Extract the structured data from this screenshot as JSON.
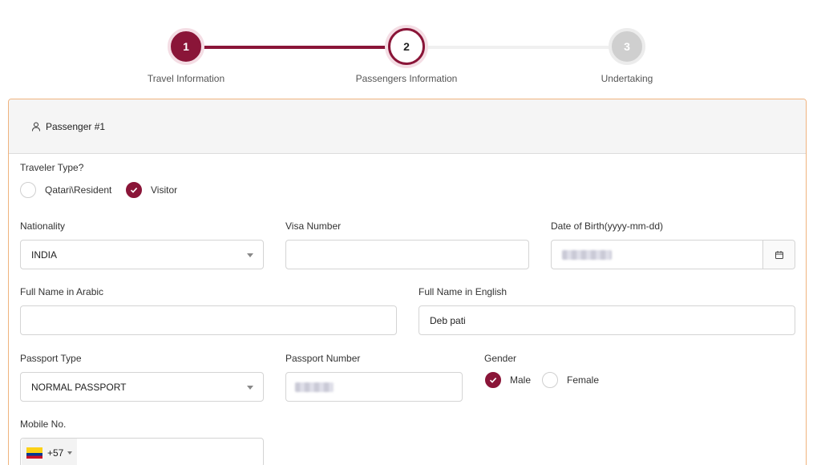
{
  "stepper": {
    "steps": [
      {
        "number": "1",
        "label": "Travel Information"
      },
      {
        "number": "2",
        "label": "Passengers Information"
      },
      {
        "number": "3",
        "label": "Undertaking"
      }
    ]
  },
  "card": {
    "title": "Passenger #1",
    "traveler_type": {
      "label": "Traveler Type?",
      "options": [
        "Qatari\\Resident",
        "Visitor"
      ],
      "selected": "Visitor"
    },
    "nationality": {
      "label": "Nationality",
      "value": "INDIA"
    },
    "visa_number": {
      "label": "Visa Number",
      "value": ""
    },
    "date_of_birth": {
      "label": "Date of Birth(yyyy-mm-dd)"
    },
    "full_name_arabic": {
      "label": "Full Name in Arabic",
      "value": ""
    },
    "full_name_english": {
      "label": "Full Name in English",
      "value": "Deb pati"
    },
    "passport_type": {
      "label": "Passport Type",
      "value": "NORMAL PASSPORT"
    },
    "passport_number": {
      "label": "Passport Number"
    },
    "gender": {
      "label": "Gender",
      "options": [
        "Male",
        "Female"
      ],
      "selected": "Male"
    },
    "mobile": {
      "label": "Mobile No.",
      "country_code": "+57"
    }
  },
  "colors": {
    "accent": "#8a1538",
    "border_highlight": "#f0b37e"
  }
}
